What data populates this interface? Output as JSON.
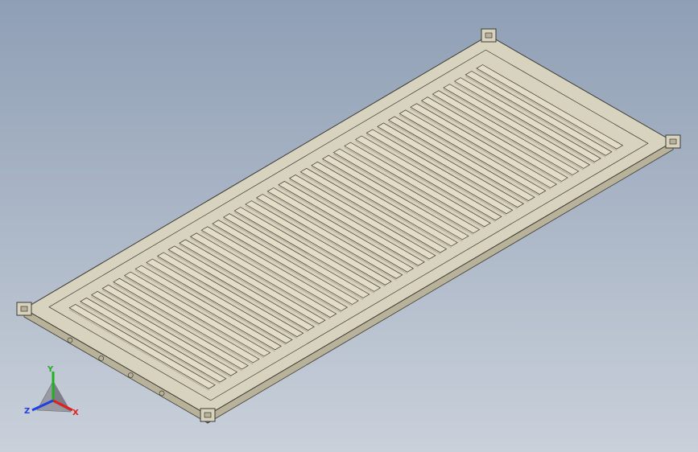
{
  "viewport": {
    "background_top": "#8f9fb5",
    "background_bottom": "#c9d0da"
  },
  "model": {
    "part_color": "#d8d3bf",
    "slat_color": "#e3ddc8",
    "edge_color": "#3c3a32",
    "shade_color": "#b9b29b",
    "slat_count": 38
  },
  "triad": {
    "x_label": "X",
    "y_label": "Y",
    "z_label": "Z",
    "x_color": "#e02020",
    "y_color": "#20b020",
    "z_color": "#2040e0"
  }
}
